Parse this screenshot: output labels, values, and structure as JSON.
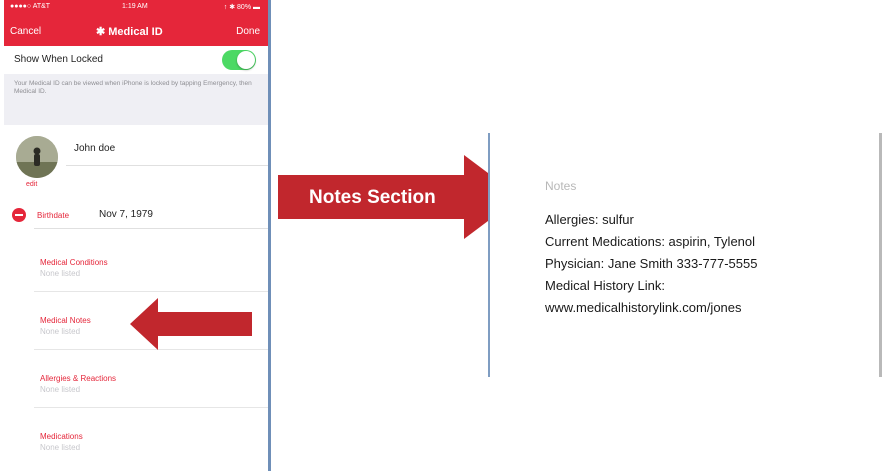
{
  "phone": {
    "status": {
      "carrier": "●●●●○ AT&T",
      "time": "1:19 AM",
      "battery": "↑ ✱ 80% ▬"
    },
    "nav": {
      "cancel": "Cancel",
      "title": "✱ Medical ID",
      "done": "Done"
    },
    "show_when_locked": {
      "label": "Show When Locked",
      "enabled": true
    },
    "lock_note": "Your Medical ID can be viewed when iPhone is locked by tapping Emergency, then Medical ID.",
    "profile": {
      "name": "John doe",
      "edit_label": "edit"
    },
    "birthdate": {
      "label": "Birthdate",
      "value": "Nov 7, 1979"
    },
    "fields": [
      {
        "title": "Medical Conditions",
        "value": "None listed"
      },
      {
        "title": "Medical Notes",
        "value": "None listed"
      },
      {
        "title": "Allergies & Reactions",
        "value": "None listed"
      },
      {
        "title": "Medications",
        "value": "None listed"
      }
    ]
  },
  "callout": {
    "label": "Notes Section",
    "color": "#c1272d"
  },
  "notes": {
    "heading": "Notes",
    "lines": [
      "Allergies: sulfur",
      "Current Medications:  aspirin, Tylenol",
      "Physician: Jane Smith 333-777-5555",
      "Medical History Link:",
      "www.medicalhistorylink.com/jones"
    ]
  },
  "colors": {
    "accent_red": "#e5263a",
    "toggle_green": "#4cd964",
    "arrow_red": "#c1272d"
  }
}
